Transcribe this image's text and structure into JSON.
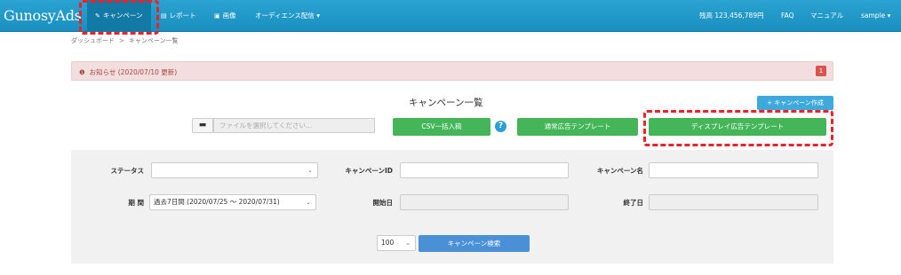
{
  "nav": {
    "brand": "GunosyAds",
    "items": [
      {
        "label": "キャンペーン",
        "icon": "tag-icon",
        "glyph": "✎"
      },
      {
        "label": "レポート",
        "icon": "report-icon",
        "glyph": "▤"
      },
      {
        "label": "画像",
        "icon": "image-icon",
        "glyph": "▣"
      },
      {
        "label": "オーディエンス配信 ▾",
        "icon": "",
        "glyph": ""
      }
    ],
    "balance": "残高 123,456,789円",
    "faq": "FAQ",
    "manual": "マニュアル",
    "user": "sample ▾"
  },
  "breadcrumb": {
    "home": "ダッシュボード",
    "sep": ">",
    "current": "キャンペーン一覧"
  },
  "alert": {
    "text": "お知らせ (2020/07/10  更新)",
    "icon": "info-icon",
    "badge": "1"
  },
  "page": {
    "title": "キャンペーン一覧",
    "create_button": "+ キャンペーン作成",
    "file_placeholder": "ファイルを選択してください...",
    "csv_button": "CSV一括入稿",
    "template_normal": "通常広告テンプレート",
    "template_display": "ディスプレイ広告テンプレート"
  },
  "search": {
    "status_label": "ステータス",
    "status_value": "",
    "campaign_id_label": "キャンペーンID",
    "campaign_id_value": "",
    "campaign_name_label": "キャンペーン名",
    "campaign_name_value": "",
    "period_label": "期 間",
    "period_value": "過去7日間 (2020/07/25 ～ 2020/07/31)",
    "start_label": "開始日",
    "start_value": "",
    "end_label": "終了日",
    "end_value": "",
    "per_page": "100",
    "search_button": "キャンペーン検索"
  },
  "colors": {
    "nav": "#1a8fbf",
    "annotation": "#e8232a",
    "green": "#45b559",
    "alert_bg": "#f2dede"
  }
}
